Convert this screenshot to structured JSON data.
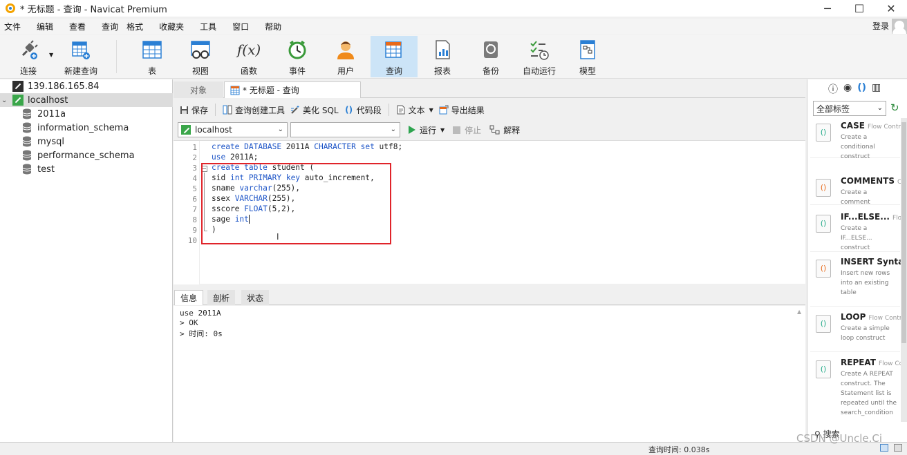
{
  "window": {
    "title": "* 无标题 - 查询 - Navicat Premium",
    "minimize": "─",
    "maximize": "☐",
    "close": "✕"
  },
  "menu": {
    "items": [
      "文件",
      "编辑",
      "查看",
      "查询",
      "格式",
      "收藏夹",
      "工具",
      "窗口",
      "帮助"
    ],
    "login": "登录"
  },
  "toolbar": {
    "connect": "连接",
    "new_query": "新建查询",
    "table": "表",
    "view": "视图",
    "function": "函数",
    "event": "事件",
    "user": "用户",
    "query": "查询",
    "report": "报表",
    "backup": "备份",
    "automation": "自动运行",
    "model": "模型",
    "function_glyph": "f(x)"
  },
  "sidebar": {
    "connections": [
      {
        "name": "139.186.165.84"
      },
      {
        "name": "localhost",
        "expander": "⌄"
      }
    ],
    "databases": [
      "2011a",
      "information_schema",
      "mysql",
      "performance_schema",
      "test"
    ]
  },
  "tabs": {
    "objects": "对象",
    "query_tab": "* 无标题 - 查询"
  },
  "query_toolbar": {
    "save": "保存",
    "query_builder": "查询创建工具",
    "beautify": "美化 SQL",
    "snippet": "代码段",
    "text": "文本",
    "export": "导出结果"
  },
  "run_bar": {
    "connection": "localhost",
    "database": "",
    "run": "运行",
    "stop": "停止",
    "explain": "解释"
  },
  "editor": {
    "line_numbers": [
      "1",
      "2",
      "3",
      "4",
      "5",
      "6",
      "7",
      "8",
      "9",
      "10"
    ],
    "lines": [
      "create DATABASE 2011A CHARACTER set utf8;",
      "use 2011A;",
      "create table student (",
      "sid int PRIMARY key auto_increment,",
      "sname varchar(255),",
      "ssex VARCHAR(255),",
      "sscore FLOAT(5,2),",
      "sage int",
      ")",
      ""
    ],
    "highlight_color": "#e0242a"
  },
  "result_tabs": {
    "info": "信息",
    "profile": "剖析",
    "status": "状态"
  },
  "output": {
    "lines": [
      "use 2011A",
      "> OK",
      "> 时间: 0s"
    ]
  },
  "right_panel": {
    "filter": "全部标签",
    "search": "搜索",
    "snippets": [
      {
        "title": "CASE",
        "sub": "Flow Contro",
        "desc": "Create a conditional construct"
      },
      {
        "title": "COMMENTS",
        "sub": "C",
        "desc": "Create a comment"
      },
      {
        "title": "IF...ELSE...",
        "sub": "Flow C",
        "desc": "Create a IF...ELSE... construct"
      },
      {
        "title": "INSERT Syntax",
        "sub": "",
        "desc": "Insert new rows into an existing table"
      },
      {
        "title": "LOOP",
        "sub": "Flow Contr",
        "desc": "Create a simple loop construct"
      },
      {
        "title": "REPEAT",
        "sub": "Flow Co",
        "desc": "Create A REPEAT construct. The Statement list is repeated until the search_condition"
      }
    ]
  },
  "statusbar": {
    "query_time": "查询时间: 0.038s"
  },
  "watermark": "CSDN @Uncle.Ci"
}
